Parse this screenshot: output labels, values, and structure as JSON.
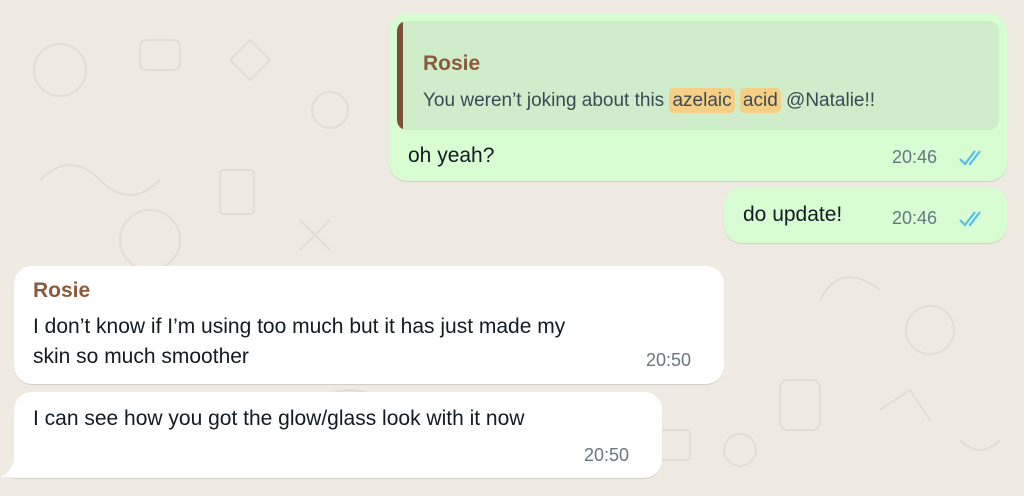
{
  "chat": {
    "messages": [
      {
        "direction": "outgoing",
        "reply_to": {
          "sender": "Rosie",
          "text_before": "You weren’t joking about this ",
          "highlight_1": "azelaic",
          "highlight_2": "acid",
          "mention": "@Natalie!!"
        },
        "text": "oh yeah?",
        "time": "20:46",
        "status": "read"
      },
      {
        "direction": "outgoing",
        "text": "do update!",
        "time": "20:46",
        "status": "read"
      },
      {
        "direction": "incoming",
        "sender": "Rosie",
        "text_line_1": "I don’t know if I’m using too much but it has just made my",
        "text_line_2": "skin so much smoother",
        "time": "20:50"
      },
      {
        "direction": "incoming",
        "text": "I can see how you got the glow/glass look with it now",
        "time": "20:50"
      }
    ]
  },
  "colors": {
    "background": "#efeae2",
    "outgoing_bubble": "#d9fdd3",
    "incoming_bubble": "#ffffff",
    "sender_name": "#8b5a3c",
    "read_ticks": "#53bdeb",
    "highlight": "#f5cf86"
  },
  "icons": {
    "read_status": "double-check-icon",
    "wallpaper": "doodle-pattern"
  }
}
